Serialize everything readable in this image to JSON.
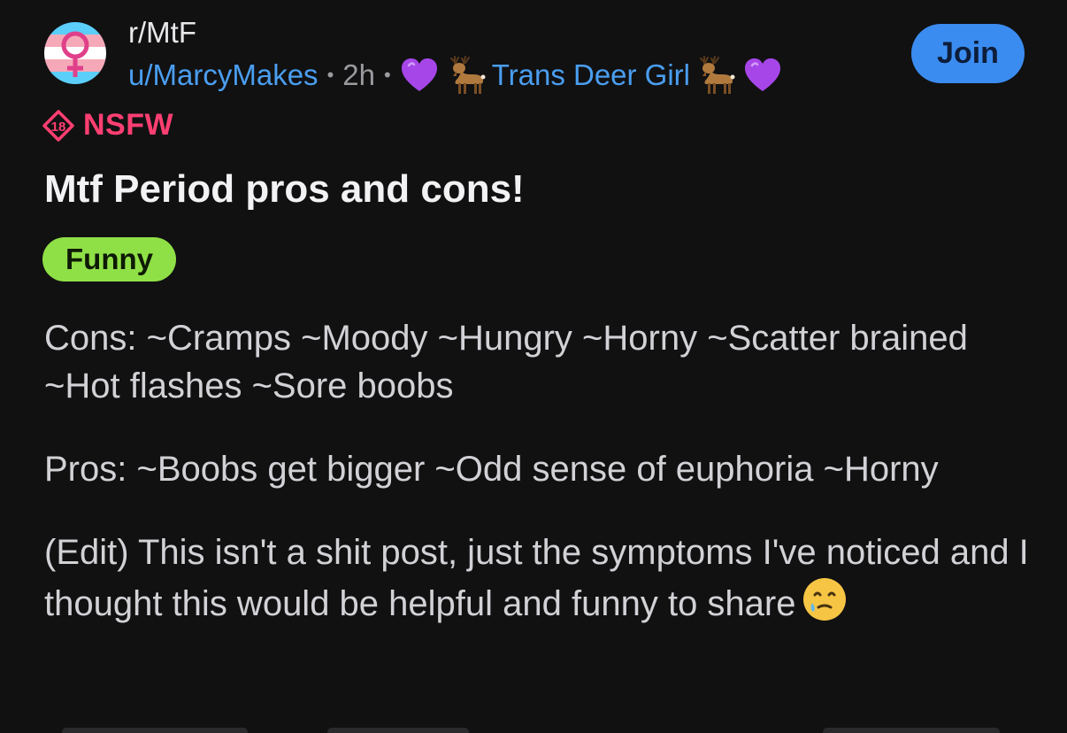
{
  "post": {
    "subreddit": "r/MtF",
    "username": "u/MarcyMakes",
    "separator": "•",
    "age": "2h",
    "user_flair": "Trans Deer Girl",
    "join_label": "Join",
    "nsfw_badge": "18",
    "nsfw_label": "NSFW",
    "title": "Mtf Period pros and cons!",
    "flair": "Funny",
    "body": {
      "cons": "Cons: ~Cramps ~Moody ~Hungry ~Horny ~Scatter brained ~Hot flashes ~Sore boobs",
      "pros": "Pros: ~Boobs get bigger ~Odd sense of euphoria ~Horny",
      "edit": "(Edit) This isn't a shit post, just the symptoms I've noticed and I thought this would be helpful and funny to share"
    }
  },
  "icons": {
    "avatar": "trans-flag-venus-icon",
    "heart": "purple-heart-icon",
    "deer": "deer-icon",
    "nsfw": "nsfw-18-badge-icon",
    "emoji_end": "face-holding-back-tears-icon"
  },
  "colors": {
    "background": "#111112",
    "link": "#4a9ef0",
    "join": "#3b8cf0",
    "nsfw": "#ff3f72",
    "flair": "#8fe046"
  }
}
